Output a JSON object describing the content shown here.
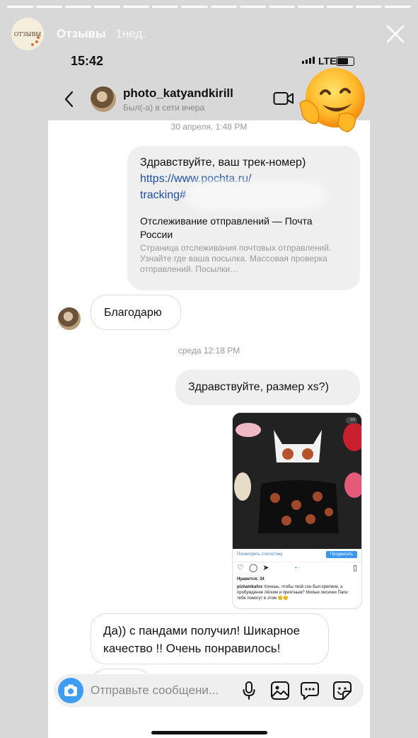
{
  "story": {
    "account_name": "Отзывы",
    "time_ago": "1нед.",
    "avatar_text": "ОТЗЫВЫ"
  },
  "phone": {
    "time": "15:42",
    "network": "LTE"
  },
  "chat_header": {
    "username": "photo_katyandkirill",
    "status": "Был(-а) в сети вчера"
  },
  "messages": {
    "date1": "30 апреля, 1:48 PM",
    "link_msg": {
      "text": "Здравствуйте, ваш трек-номер)",
      "url_line1": "https://www.pochta.ru/",
      "url_line2": "tracking#",
      "preview_title": "Отслеживание отправлений — Почта России",
      "preview_desc": "Страница отслеживания почтовых отправлений. Узнайте где ваша посылка. Массовая проверка отправлений. Посылки…"
    },
    "thanks": "Благодарю",
    "date2": "среда 12:18 PM",
    "size_question": "Здравствуйте, размер xs?)",
    "shared_post": {
      "stats_link": "Посмотреть статистику",
      "promote_button": "Продвигать",
      "counter": "1/2",
      "likes": "Нравится: 34",
      "caption_user": "pizhamkafox",
      "caption_text": "Хочешь, чтобы твой сон был крепким, а пробуждение лёгким и приятным? Милые лисички Папи тебе помогут в этом 😊😊"
    },
    "reply": "Да)) с пандами получил! Шикарное качество !! Очень понравилось!"
  },
  "composer": {
    "placeholder": "Отправьте сообщени..."
  },
  "colors": {
    "link": "#1b4fa3",
    "camera_button": "#3c9df2",
    "outgoing_bubble": "#efefef"
  },
  "icons": [
    "close-icon",
    "back-chevron-icon",
    "video-call-icon",
    "hugging-face-emoji",
    "camera-icon",
    "microphone-icon",
    "gallery-icon",
    "chat-bubble-icon",
    "sticker-icon"
  ]
}
